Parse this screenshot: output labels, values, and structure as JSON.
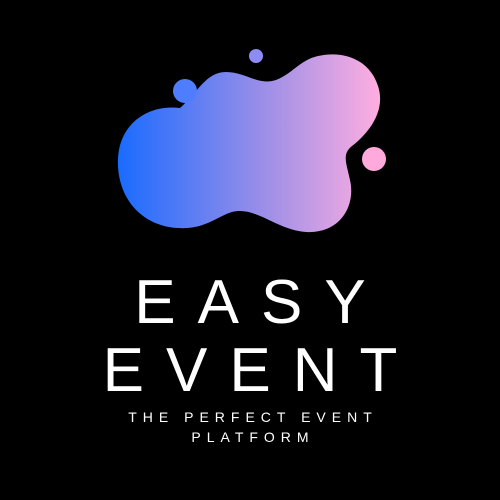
{
  "brand": {
    "name_line_1": "EASY",
    "name_line_2": "EVENT",
    "tagline_line_1": "THE PERFECT EVENT",
    "tagline_line_2": "PLATFORM"
  },
  "logo": {
    "icon": "cloud-blob-icon",
    "gradient_start": "#1a6bff",
    "gradient_end": "#ffaee0",
    "dot_color_blue": "#4f7dff",
    "dot_color_violet": "#8d8cf6",
    "dot_color_pink": "#ffa9dc"
  },
  "colors": {
    "background": "#000000",
    "text": "#ffffff"
  }
}
